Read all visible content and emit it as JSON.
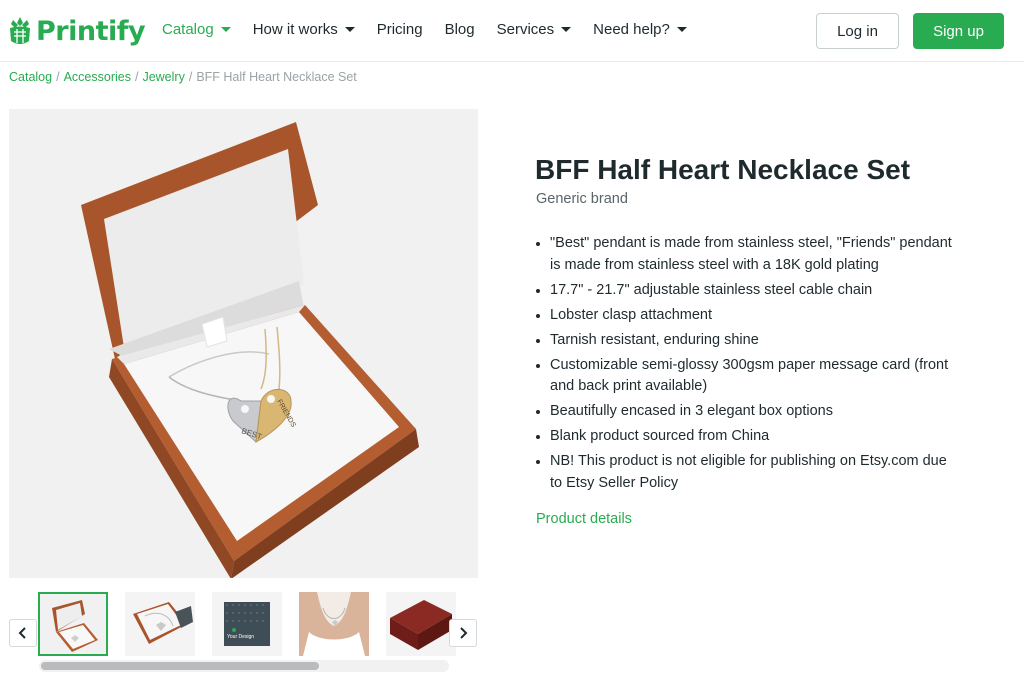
{
  "header": {
    "logo_text": "Printify",
    "nav": [
      {
        "label": "Catalog",
        "has_caret": true,
        "active": true
      },
      {
        "label": "How it works",
        "has_caret": true,
        "active": false
      },
      {
        "label": "Pricing",
        "has_caret": false,
        "active": false
      },
      {
        "label": "Blog",
        "has_caret": false,
        "active": false
      },
      {
        "label": "Services",
        "has_caret": true,
        "active": false
      },
      {
        "label": "Need help?",
        "has_caret": true,
        "active": false
      }
    ],
    "login_label": "Log in",
    "signup_label": "Sign up"
  },
  "breadcrumb": {
    "links": [
      "Catalog",
      "Accessories",
      "Jewelry"
    ],
    "separator": "/",
    "current": "BFF Half Heart Necklace Set"
  },
  "product": {
    "title": "BFF Half Heart Necklace Set",
    "brand": "Generic brand",
    "features": [
      "\"Best\" pendant is made from stainless steel, \"Friends\" pendant is made from stainless steel with a 18K gold plating",
      "17.7\" - 21.7\" adjustable stainless steel cable chain",
      "Lobster clasp attachment",
      "Tarnish resistant, enduring shine",
      "Customizable semi-glossy 300gsm paper message card (front and back print available)",
      "Beautifully encased in 3 elegant box options",
      "Blank product sourced from China",
      "NB! This product is not eligible for publishing on Etsy.com due to Etsy Seller Policy"
    ],
    "details_link": "Product details",
    "pendant_text_left": "BEST",
    "pendant_text_right": "FRIENDS",
    "thumb_card_text": "Your Design"
  },
  "colors": {
    "brand_green": "#29ab51",
    "box_brown": "#a9552c",
    "text_dark": "#1f2a2e"
  },
  "icons": {
    "logo": "printify-logo-icon",
    "prev": "chevron-left-icon",
    "next": "chevron-right-icon"
  }
}
